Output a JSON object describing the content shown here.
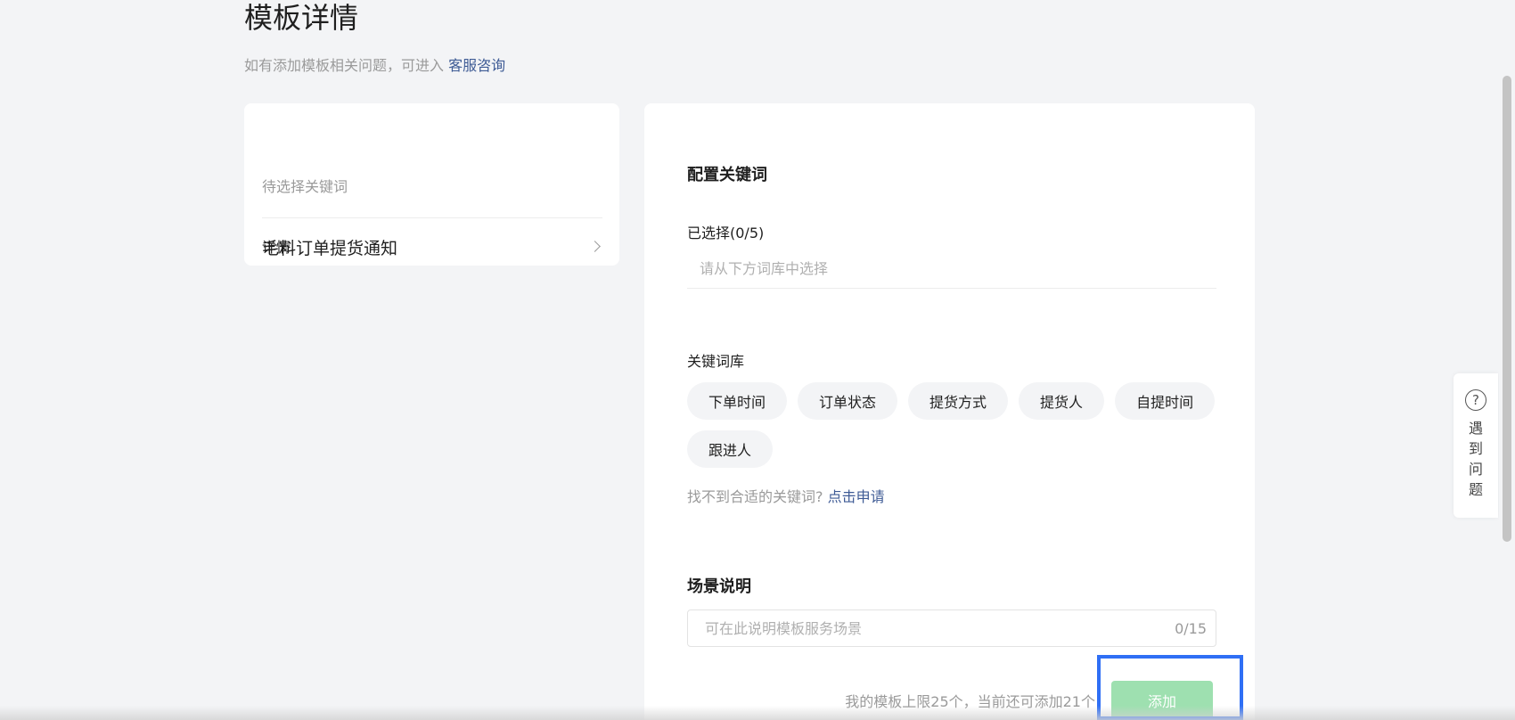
{
  "header": {
    "title": "模板详情",
    "subtitle_text": "如有添加模板相关问题，可进入",
    "subtitle_link": "客服咨询"
  },
  "template_card": {
    "name": "毛料订单提货通知",
    "status": "待选择关键词",
    "detail_label": "详情"
  },
  "config": {
    "section_title": "配置关键词",
    "selected_label": "已选择(0/5)",
    "selected_placeholder": "请从下方词库中选择",
    "library_label": "关键词库",
    "keywords": [
      "下单时间",
      "订单状态",
      "提货方式",
      "提货人",
      "自提时间",
      "跟进人"
    ],
    "hint_text": "找不到合适的关键词?",
    "hint_link": "点击申请"
  },
  "scene": {
    "section_title": "场景说明",
    "placeholder": "可在此说明模板服务场景",
    "counter": "0/15"
  },
  "footer": {
    "limit_text": "我的模板上限25个，当前还可添加21个",
    "add_button": "添加",
    "add_button_color": "#9ee0b0"
  },
  "help_widget": {
    "icon": "question-circle-icon",
    "label": "遇到问题"
  },
  "colors": {
    "link": "#3e5b95",
    "highlight": "#2f6ff5",
    "background": "#f3f4f6"
  }
}
